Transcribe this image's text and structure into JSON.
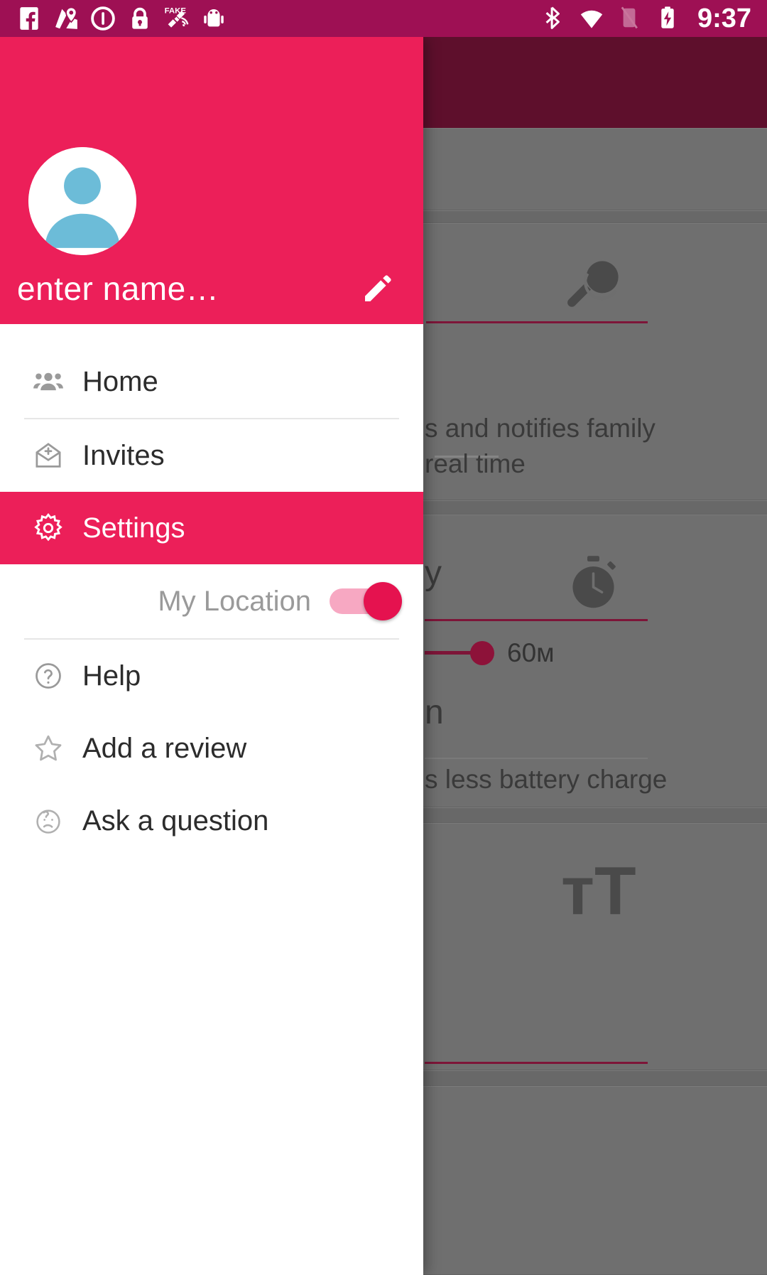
{
  "status_bar": {
    "time": "9:37",
    "left_icons": [
      {
        "name": "facebook-icon",
        "label": "Facebook"
      },
      {
        "name": "maps-location-icon",
        "label": "Maps"
      },
      {
        "name": "info-circle-icon",
        "label": "Info"
      },
      {
        "name": "lock-icon",
        "label": "Screen lock"
      },
      {
        "name": "fake-gps-satellite-icon",
        "label": "FAKE GPS"
      },
      {
        "name": "android-robot-icon",
        "label": "Android"
      }
    ],
    "right_icons": [
      {
        "name": "bluetooth-icon",
        "label": "Bluetooth"
      },
      {
        "name": "wifi-icon",
        "label": "Wi-Fi"
      },
      {
        "name": "no-sim-icon",
        "label": "No SIM"
      },
      {
        "name": "battery-charging-icon",
        "label": "Charging"
      }
    ]
  },
  "drawer": {
    "accent_color": "#ec1f59",
    "header": {
      "avatar_icon": "person-avatar-icon",
      "name": "enter name…",
      "edit_icon": "pencil-edit-icon"
    },
    "menu": [
      {
        "id": "home",
        "label": "Home",
        "icon": "people-group-icon",
        "active": false
      },
      {
        "id": "invites",
        "label": "Invites",
        "icon": "envelope-add-icon",
        "active": false
      },
      {
        "id": "settings",
        "label": "Settings",
        "icon": "gear-icon",
        "active": true
      },
      {
        "id": "help",
        "label": "Help",
        "icon": "question-circle-icon",
        "active": false
      },
      {
        "id": "add-review",
        "label": "Add a review",
        "icon": "star-outline-icon",
        "active": false
      },
      {
        "id": "ask-question",
        "label": "Ask a question",
        "icon": "confused-face-icon",
        "active": false
      }
    ],
    "location_toggle": {
      "label": "My Location",
      "state": "on",
      "track_color": "#f7a8c2",
      "knob_color": "#e5124f"
    }
  },
  "background": {
    "appbar_color": "#5e0f2c",
    "scrim_color": "#6e6e6e",
    "accent_line_color": "#7d1538",
    "chips": [
      {
        "name": "orange-square",
        "color": "#a5700a"
      },
      {
        "name": "navy-square",
        "color": "#1c2a56"
      }
    ],
    "texts": [
      {
        "id": "notify-line1",
        "text": "s and notifies family"
      },
      {
        "id": "notify-line2",
        "text": "real time"
      },
      {
        "id": "privacy-partial",
        "text": "y"
      },
      {
        "id": "section-partial",
        "text": "n"
      },
      {
        "id": "battery-line",
        "text": "s less battery charge"
      }
    ],
    "slider": {
      "value_label": "60м",
      "percent": 42
    },
    "icons": [
      {
        "name": "rattle-toy-icon"
      },
      {
        "name": "stopwatch-icon"
      },
      {
        "name": "text-size-icon",
        "glyph": "тT"
      }
    ]
  }
}
